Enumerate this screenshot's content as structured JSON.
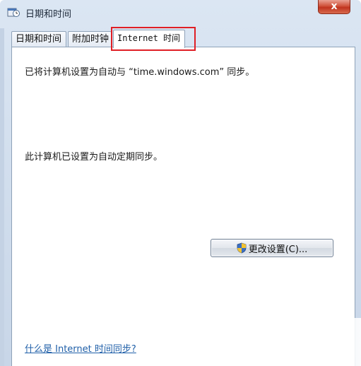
{
  "window": {
    "title": "日期和时间",
    "close_label": "x"
  },
  "tabs": [
    {
      "label": "日期和时间"
    },
    {
      "label": "附加时钟"
    },
    {
      "label": "Internet 时间"
    }
  ],
  "internet_time": {
    "sync_status": "已将计算机设置为自动与 “time.windows.com” 同步。",
    "schedule_status": "此计算机已设置为自动定期同步。",
    "change_settings_label": "更改设置(C)...",
    "help_link": "什么是 Internet 时间同步?"
  },
  "colors": {
    "highlight_box": "#e01f25",
    "link": "#1f5fa8"
  }
}
